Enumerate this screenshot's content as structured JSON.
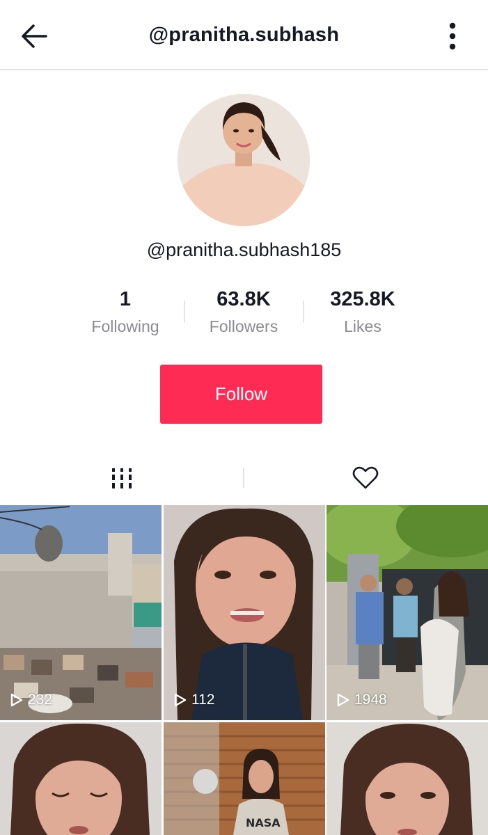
{
  "header": {
    "title": "@pranitha.subhash",
    "back_icon": "arrow-left-icon",
    "more_icon": "vertical-ellipsis-icon"
  },
  "profile": {
    "username": "@pranitha.subhash185",
    "stats": [
      {
        "value": "1",
        "label": "Following"
      },
      {
        "value": "63.8K",
        "label": "Followers"
      },
      {
        "value": "325.8K",
        "label": "Likes"
      }
    ],
    "follow_label": "Follow"
  },
  "tabs": [
    {
      "icon": "videos-grid-icon",
      "selected": true
    },
    {
      "icon": "heart-outline-icon",
      "selected": false
    }
  ],
  "videos": [
    {
      "views": "232",
      "thumbnail": "rooftop-scene"
    },
    {
      "views": "112",
      "thumbnail": "woman-talking-closeup"
    },
    {
      "views": "1948",
      "thumbnail": "people-with-dog-outdoors"
    },
    {
      "views": "",
      "thumbnail": "woman-face-closeup"
    },
    {
      "views": "",
      "thumbnail": "woman-in-room"
    },
    {
      "views": "",
      "thumbnail": "woman-face-closeup"
    }
  ],
  "colors": {
    "accent": "#fe2c55",
    "text_primary": "#161823",
    "text_secondary": "#8a8b91",
    "divider": "#e3e3e4"
  }
}
